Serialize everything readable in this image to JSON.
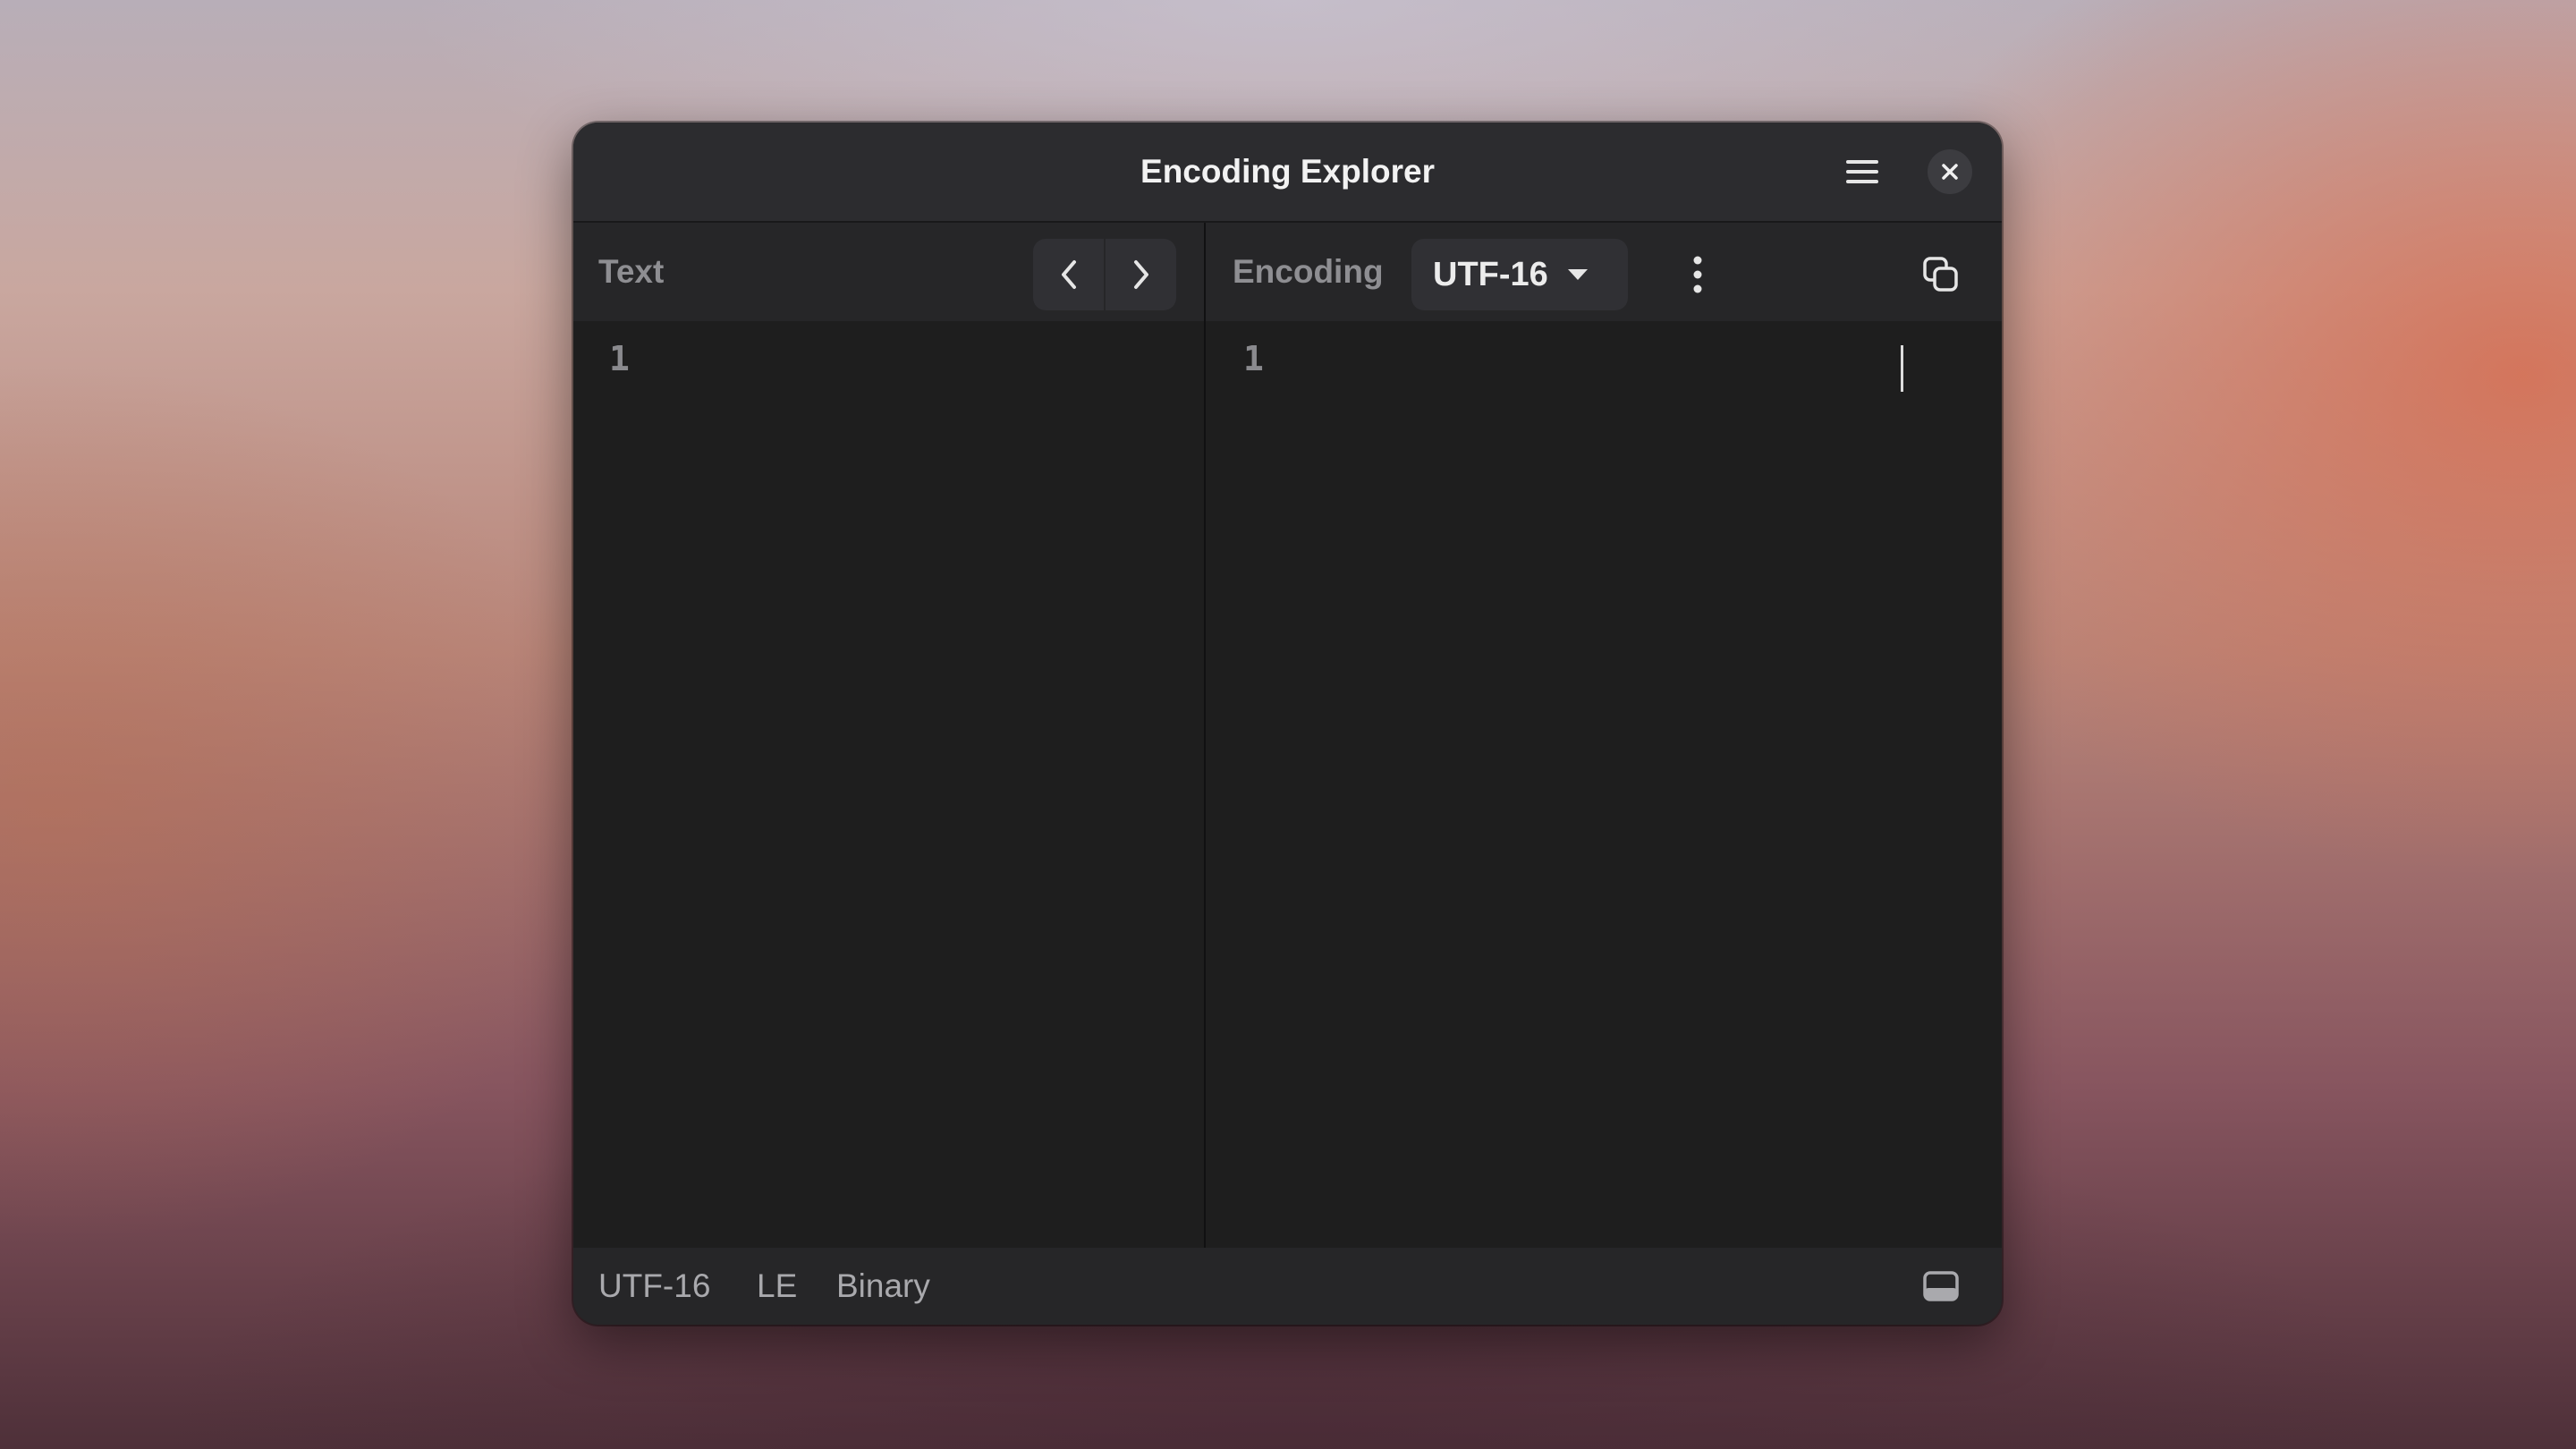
{
  "window": {
    "title": "Encoding Explorer"
  },
  "left_pane": {
    "label": "Text",
    "line_number": "1"
  },
  "right_pane": {
    "label": "Encoding",
    "encoding_select": "UTF-16",
    "line_number": "1"
  },
  "statusbar": {
    "encoding": "UTF-16",
    "endianness": "LE",
    "format": "Binary"
  },
  "icons": {
    "menu": "hamburger-menu-icon",
    "close": "close-icon",
    "previous": "chevron-left-icon",
    "next": "chevron-right-icon",
    "dropdown": "caret-down-icon",
    "more": "vertical-ellipsis-icon",
    "copy": "copy-icon",
    "panel": "bottom-panel-icon"
  },
  "colors": {
    "window_bg": "#1e1e1e",
    "header_bg": "#262628",
    "titlebar_bg": "#2c2c2f",
    "button_bg": "#303034",
    "text_primary": "#f2f2f2",
    "text_muted": "#8e8e92"
  }
}
